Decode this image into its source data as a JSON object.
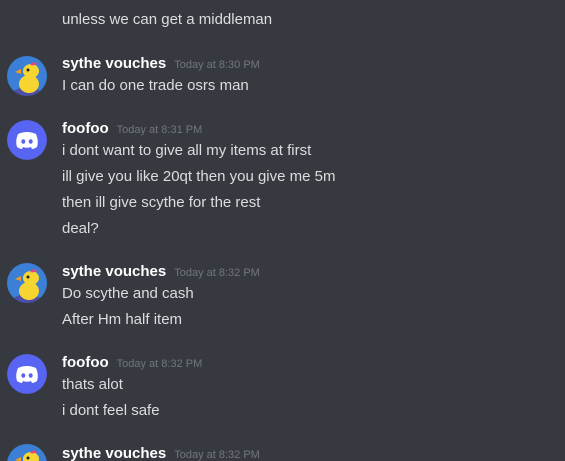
{
  "messages": [
    {
      "continuation": true,
      "lines": [
        "unless we can get a middleman"
      ]
    },
    {
      "author": "sythe vouches",
      "avatar": "duck-avatar",
      "timestamp": "Today at 8:30 PM",
      "lines": [
        "I can do one trade osrs man"
      ]
    },
    {
      "author": "foofoo",
      "avatar": "discord-default-avatar",
      "timestamp": "Today at 8:31 PM",
      "lines": [
        "i dont want to give all my items at first",
        "ill give you like 20qt then you give me 5m",
        "then ill give scythe for the rest",
        "deal?"
      ]
    },
    {
      "author": "sythe vouches",
      "avatar": "duck-avatar",
      "timestamp": "Today at 8:32 PM",
      "lines": [
        "Do scythe and cash",
        "After Hm half item"
      ]
    },
    {
      "author": "foofoo",
      "avatar": "discord-default-avatar",
      "timestamp": "Today at 8:32 PM",
      "lines": [
        "thats alot",
        "i dont feel safe"
      ]
    },
    {
      "author": "sythe vouches",
      "avatar": "duck-avatar",
      "timestamp": "Today at 8:32 PM",
      "lines": []
    }
  ],
  "colors": {
    "background": "#36393f",
    "message_text": "#dcddde",
    "author_text": "#ffffff",
    "timestamp_text": "#72767d",
    "discord_blurple": "#5865f2",
    "duck_avatar_bg": "#3b7fd6",
    "duck_body": "#f7d531"
  }
}
